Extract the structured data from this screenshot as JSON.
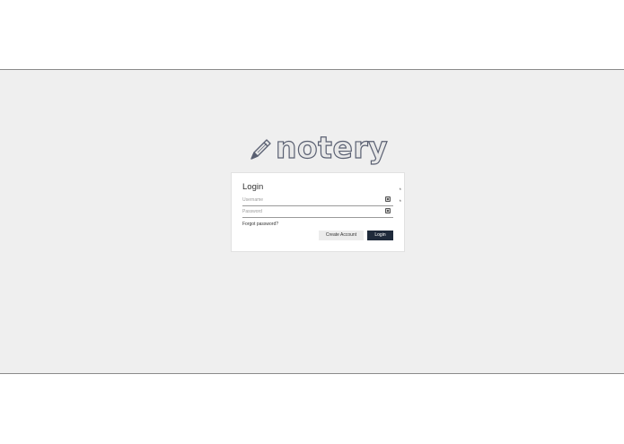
{
  "logo": {
    "text": "notery"
  },
  "login": {
    "title": "Login",
    "username": {
      "placeholder": "Username",
      "value": ""
    },
    "password": {
      "placeholder": "Password",
      "value": ""
    },
    "required_mark": "*",
    "forgot_label": "Forgot password?",
    "create_account_label": "Create Account",
    "login_label": "Login"
  },
  "colors": {
    "app_background": "#efefef",
    "primary_button": "#1f2a3b",
    "secondary_button": "#ececec"
  }
}
